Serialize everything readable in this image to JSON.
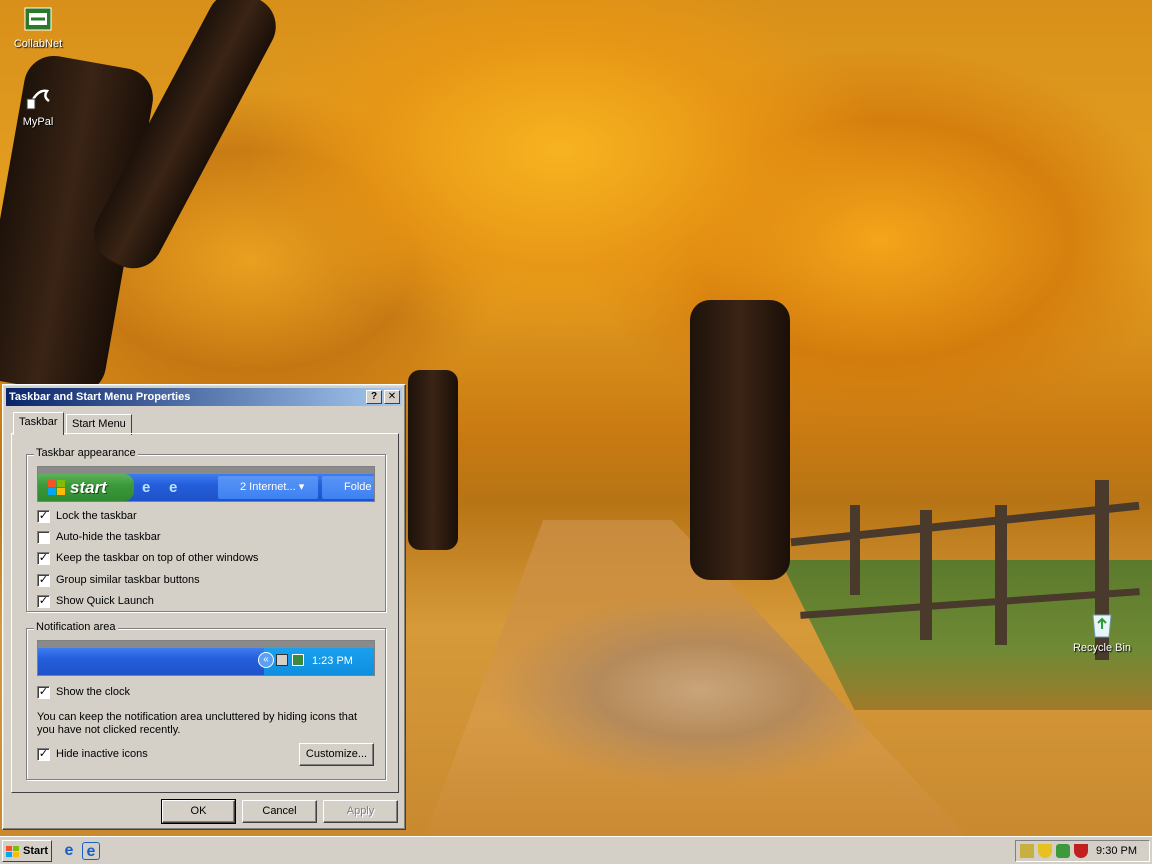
{
  "desktop": {
    "icons": [
      {
        "label": "CollabNet",
        "icon": "collabnet-icon"
      },
      {
        "label": "MyPal",
        "icon": "mypal-icon"
      },
      {
        "label": "Recycle Bin",
        "icon": "recycle-bin-icon"
      }
    ]
  },
  "dialog": {
    "title": "Taskbar and Start Menu Properties",
    "help_btn": "?",
    "close_btn": "✕",
    "tabs": [
      {
        "label": "Taskbar",
        "active": true
      },
      {
        "label": "Start Menu",
        "active": false
      }
    ],
    "appearance": {
      "group_label": "Taskbar appearance",
      "preview": {
        "start_label": "start",
        "buttons": [
          "2 Internet...",
          "Folde"
        ]
      },
      "options": [
        {
          "label": "Lock the taskbar",
          "checked": true
        },
        {
          "label": "Auto-hide the taskbar",
          "checked": false
        },
        {
          "label": "Keep the taskbar on top of other windows",
          "checked": true
        },
        {
          "label": "Group similar taskbar buttons",
          "checked": true
        },
        {
          "label": "Show Quick Launch",
          "checked": true
        }
      ]
    },
    "notification": {
      "group_label": "Notification area",
      "preview_clock": "1:23 PM",
      "show_clock": {
        "label": "Show the clock",
        "checked": true
      },
      "description": "You can keep the notification area uncluttered by hiding icons that you have not clicked recently.",
      "hide_inactive": {
        "label": "Hide inactive icons",
        "checked": true
      },
      "customize_label": "Customize..."
    },
    "buttons": {
      "ok": "OK",
      "cancel": "Cancel",
      "apply": "Apply"
    }
  },
  "taskbar": {
    "start_label": "Start",
    "clock": "9:30 PM"
  },
  "colors": {
    "title_active": "#0a246a",
    "xp_blue": "#245edb",
    "xp_green": "#3c9a3a",
    "dialog_face": "#d4d0c8"
  }
}
